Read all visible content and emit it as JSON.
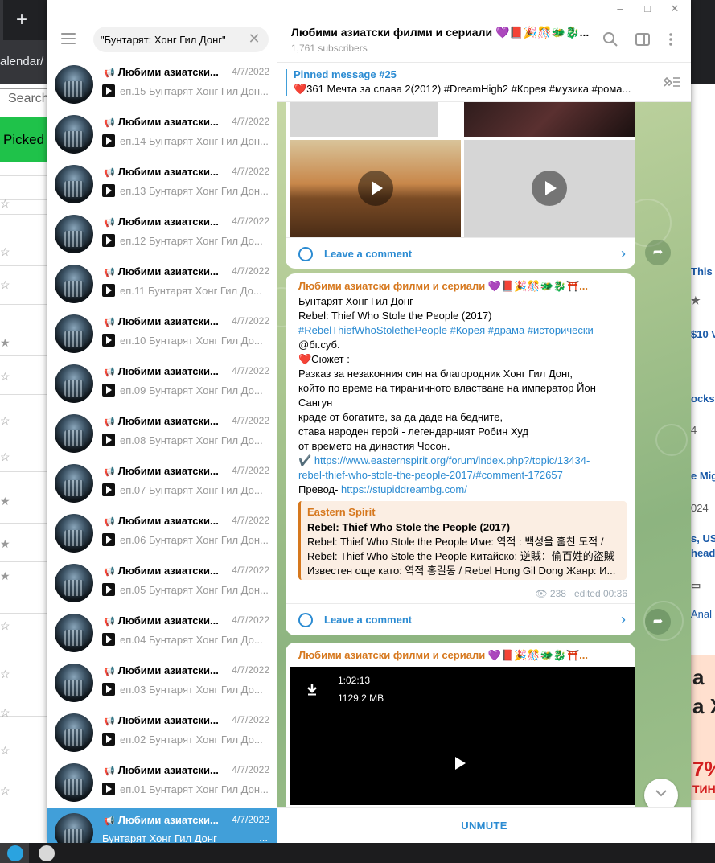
{
  "background": {
    "address_fragment": "alendar/",
    "search_fragment": "Search",
    "picked_label": "Picked",
    "right_snippets": [
      "This",
      "$10 V",
      "ocks",
      "4",
      "e Mig",
      "024",
      "s, US",
      "head",
      "Anal"
    ],
    "promo_snippets": [
      "а",
      "а Х",
      "7%",
      "ТИН"
    ]
  },
  "window": {
    "minimize": "–",
    "maximize": "□",
    "close": "✕"
  },
  "search": {
    "value": "\"Бунтарят: Хонг Гил Донг\""
  },
  "chat_list": [
    {
      "title": "Любими азиатски...",
      "date": "4/7/2022",
      "preview": "еп.15 Бунтарят Хонг Гил Дон..."
    },
    {
      "title": "Любими азиатски...",
      "date": "4/7/2022",
      "preview": "еп.14 Бунтарят Хонг Гил Дон..."
    },
    {
      "title": "Любими азиатски...",
      "date": "4/7/2022",
      "preview": "еп.13 Бунтарят Хонг Гил Дон..."
    },
    {
      "title": "Любими азиатски...",
      "date": "4/7/2022",
      "preview": "еп.12   Бунтарят Хонг Гил До..."
    },
    {
      "title": "Любими азиатски...",
      "date": "4/7/2022",
      "preview": "еп.11  Бунтарят Хонг Гил До..."
    },
    {
      "title": "Любими азиатски...",
      "date": "4/7/2022",
      "preview": "еп.10  Бунтарят Хонг Гил До..."
    },
    {
      "title": "Любими азиатски...",
      "date": "4/7/2022",
      "preview": "еп.09   Бунтарят Хонг Гил До..."
    },
    {
      "title": "Любими азиатски...",
      "date": "4/7/2022",
      "preview": "еп.08  Бунтарят Хонг Гил До..."
    },
    {
      "title": "Любими азиатски...",
      "date": "4/7/2022",
      "preview": "еп.07  Бунтарят Хонг Гил До..."
    },
    {
      "title": "Любими азиатски...",
      "date": "4/7/2022",
      "preview": "еп.06 Бунтарят Хонг Гил Дон..."
    },
    {
      "title": "Любими азиатски...",
      "date": "4/7/2022",
      "preview": "еп.05 Бунтарят Хонг Гил Дон..."
    },
    {
      "title": "Любими азиатски...",
      "date": "4/7/2022",
      "preview": "еп.04  Бунтарят Хонг Гил До..."
    },
    {
      "title": "Любими азиатски...",
      "date": "4/7/2022",
      "preview": "еп.03  Бунтарят Хонг Гил До..."
    },
    {
      "title": "Любими азиатски...",
      "date": "4/7/2022",
      "preview": "еп.02  Бунтарят Хонг Гил До..."
    },
    {
      "title": "Любими азиатски...",
      "date": "4/7/2022",
      "preview": "еп.01 Бунтарят Хонг Гил Дон..."
    },
    {
      "title": "Любими азиатски...",
      "date": "4/7/2022",
      "preview": "Бунтарят Хонг Гил Донг",
      "extra": "..."
    }
  ],
  "channel": {
    "title": "Любими азиатски филми и сериали 💜📕🎉🎊🐲🐉...",
    "subscribers": "1,761 subscribers"
  },
  "pinned": {
    "label": "Pinned message #25",
    "text": "❤️361 Мечта за слава 2(2012)  #DreamHigh2 #Корея #музика #рома..."
  },
  "messages": {
    "first_comment": "Leave a comment",
    "post": {
      "author": "Любими азиатски филми и сериали 💜📕🎉🎊🐲🐉⛩️...",
      "lines": [
        "Бунтарят Хонг Гил Донг",
        "Rebel: Thief Who Stole the People (2017)",
        "#RebelThiefWhoStolethePeople #Корея #драма #исторически",
        "@бг.суб.",
        "❤️Сюжет :",
        "Разказ за незаконния син на благородник Хонг Гил Донг,",
        "който по време на тираничното властване на император Йон",
        "Сангун",
        "краде от богатите, за да даде на бедните,",
        "става народен герой - легендарният Робин Худ",
        "от времето на династия Чосон."
      ],
      "link1_prefix": "✔️ ",
      "link1_a": "https://www.easternspirit.org/forum/index.php?/topic/13434-",
      "link1_b": "rebel-thief-who-stole-the-people-2017/#comment-172657",
      "translation_prefix": "Превод- ",
      "translation_link": "https://stupiddreambg.com/",
      "quote": {
        "source": "Eastern Spirit",
        "title": "Rebel: Thief Who Stole the People (2017)",
        "line1": "Rebel: Thief Who Stole the People Име: 역적 : 백성을 훔친 도적 /",
        "line2": "Rebel: Thief Who Stole the People Китайско: 逆賊：偷百姓的盜賊",
        "line3": "Известен още като: 역적 홍길동 / Rebel Hong Gil Dong Жанр: И..."
      },
      "views": "238",
      "edited": "edited 00:36",
      "comment": "Leave a comment"
    },
    "video_post": {
      "author": "Любими азиатски филми и сериали 💜📕🎉🎊🐲🐉⛩️...",
      "duration": "1:02:13",
      "size": "1129.2 MB"
    }
  },
  "bottom": {
    "unmute": "UNMUTE"
  },
  "icons": {
    "search": "search-icon",
    "columns": "sidebar-toggle-icon",
    "more": "more-vertical-icon"
  }
}
